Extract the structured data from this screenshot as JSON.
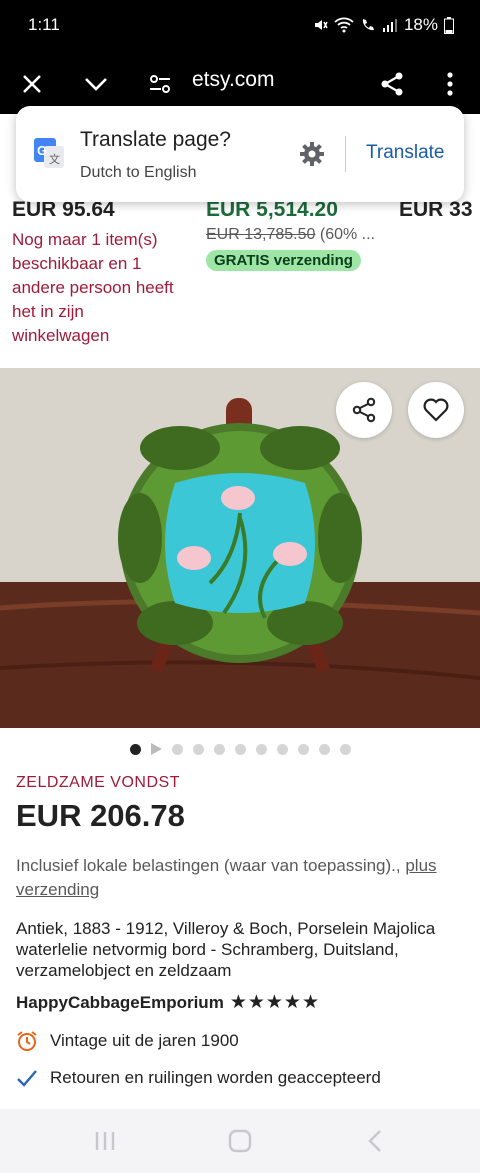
{
  "status_bar": {
    "time": "1:11",
    "battery": "18%"
  },
  "browser": {
    "url": "etsy.com"
  },
  "translate_prompt": {
    "title": "Translate page?",
    "subtitle": "Dutch to English",
    "action": "Translate"
  },
  "recommendations": [
    {
      "price": "EUR 95.64",
      "scarcity": "Nog maar 1 item(s) beschikbaar en 1 andere persoon heeft het in zijn winkelwagen"
    },
    {
      "price": "EUR 5,514.20",
      "original_price": "EUR 13,785.50",
      "discount": "(60% ...",
      "badge": "GRATIS verzending"
    },
    {
      "price": "EUR 33"
    }
  ],
  "image_carousel": {
    "total": 11,
    "active_index": 0
  },
  "listing": {
    "badge": "ZELDZAME VONDST",
    "price": "EUR 206.78",
    "tax_text": "Inclusief lokale belastingen (waar van toepassing).,",
    "shipping_link": "plus verzending",
    "title": "Antiek, 1883 - 1912, Villeroy & Boch, Porselein Majolica waterlelie netvormig bord - Schramberg, Duitsland, verzamelobject en zeldzaam",
    "shop_name": "HappyCabbageEmporium",
    "stars": "★★★★★",
    "features": [
      {
        "icon": "alarm-clock-icon",
        "text": "Vintage uit de jaren 1900"
      },
      {
        "icon": "checkmark-icon",
        "text": "Retouren en ruilingen worden geaccepteerd"
      }
    ]
  },
  "colors": {
    "accent_red": "#a11a3a",
    "sale_green": "#1c6b3a",
    "link_blue": "#1a5ba6",
    "plate_turquoise": "#3cc7d6"
  }
}
